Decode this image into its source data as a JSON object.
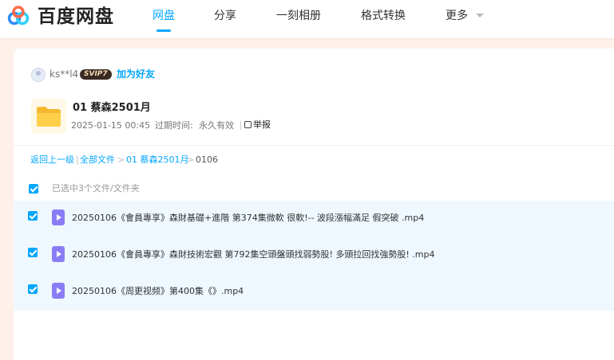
{
  "header": {
    "brand": "百度网盘",
    "nav": [
      "网盘",
      "分享",
      "一刻相册",
      "格式转换",
      "更多"
    ],
    "active_nav": "网盘",
    "accent_color": "#06a7ff"
  },
  "share": {
    "user": "ks**l4",
    "vip_badge": "SVIP7",
    "add_friend": "加为好友",
    "title": "01 蔡森2501月",
    "date": "2025-01-15 00:45",
    "expiry_label": "过期时间:",
    "expiry_value": "永久有效",
    "report": "举报"
  },
  "breadcrumb": {
    "back": "返回上一级",
    "divider": "|",
    "all_files": "全部文件",
    "sep": ">",
    "folder": "01 蔡森2501月",
    "current": "0106"
  },
  "selection": {
    "text": "已选中3个文件/文件夹"
  },
  "files": [
    "20250106《會員專享》森財基礎+進階 第374集微軟 很軟!-- 波段漲幅滿足 假突破 .mp4",
    "20250106《會員專享》森財技術宏觀 第792集空頭盤頭找弱勢股! 多頭拉回找強勢股! .mp4",
    "20250106《周更视频》第400集《》.mp4"
  ]
}
